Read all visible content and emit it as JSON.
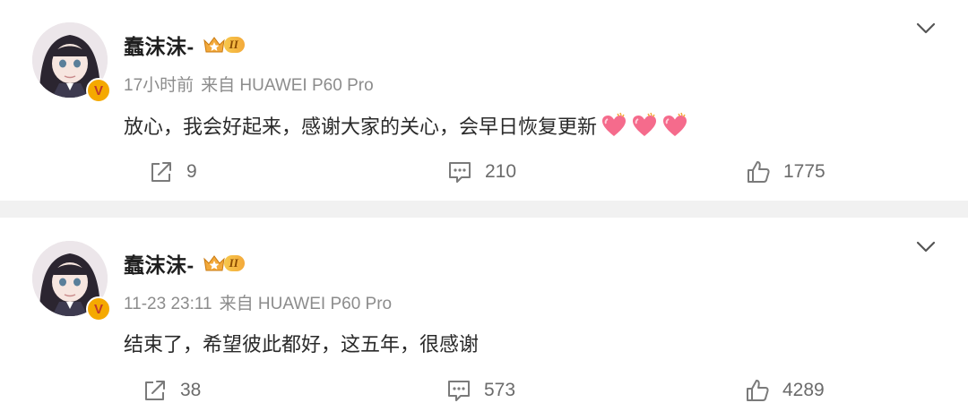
{
  "posts": [
    {
      "author": "蠢沫沫-",
      "vip_level": "II",
      "verified_badge": "V",
      "time": "17小时前",
      "source": "来自 HUAWEI P60 Pro",
      "content": "放心，我会好起来，感谢大家的关心，会早日恢复更新",
      "emoji": [
        "heart-emoji",
        "heart-emoji",
        "heart-emoji"
      ],
      "reposts": "9",
      "comments": "210",
      "likes": "1775"
    },
    {
      "author": "蠢沫沫-",
      "vip_level": "II",
      "verified_badge": "V",
      "time": "11-23 23:11",
      "source": "来自 HUAWEI P60 Pro",
      "content": "结束了，希望彼此都好，这五年，很感谢",
      "emoji": [],
      "reposts": "38",
      "comments": "573",
      "likes": "4289"
    }
  ],
  "colors": {
    "background": "#f1f1f1",
    "card": "#ffffff",
    "name": "#1f1f1f",
    "meta": "#8c8c8c",
    "action": "#6b6b6b",
    "vip_gold": "#f3a93a",
    "verified": "#f5a900"
  }
}
